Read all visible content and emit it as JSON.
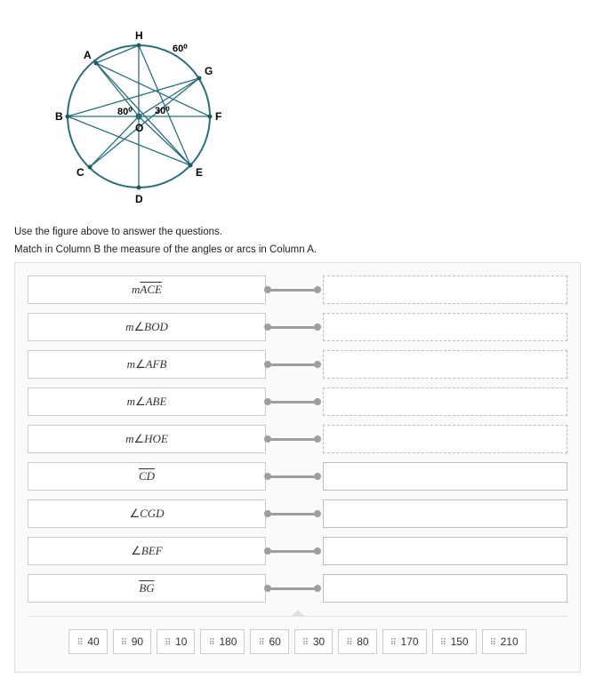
{
  "figure": {
    "points": {
      "A": "A",
      "B": "B",
      "C": "C",
      "D": "D",
      "E": "E",
      "F": "F",
      "G": "G",
      "H": "H",
      "O": "O"
    },
    "angles": {
      "HOG": "60⁰",
      "AOB": "80⁰",
      "O_right": "30⁰"
    }
  },
  "instructions": {
    "line1": "Use the figure above to answer the questions.",
    "line2": "Match in Column B the measure of the angles or arcs  in Column A."
  },
  "columnA": [
    {
      "prefix": "m",
      "arc": true,
      "body": "ACE"
    },
    {
      "prefix": "m",
      "angle": true,
      "body": "BOD"
    },
    {
      "prefix": "m",
      "angle": true,
      "body": "AFB"
    },
    {
      "prefix": "m",
      "angle": true,
      "body": "ABE"
    },
    {
      "prefix": "m",
      "angle": true,
      "body": "HOE"
    },
    {
      "prefix": "",
      "arc": true,
      "body": "CD"
    },
    {
      "prefix": "",
      "angle": true,
      "body": "CGD"
    },
    {
      "prefix": "",
      "angle": true,
      "body": "BEF"
    },
    {
      "prefix": "",
      "arc": true,
      "body": "BG"
    }
  ],
  "bank": [
    "40",
    "90",
    "10",
    "180",
    "60",
    "30",
    "80",
    "170",
    "150",
    "210"
  ],
  "chart_data": {
    "type": "diagram",
    "title": "Circle O with marked points and central angles",
    "center": "O",
    "points_on_circle": [
      "A",
      "B",
      "C",
      "D",
      "E",
      "F",
      "G",
      "H"
    ],
    "marked_angles": [
      {
        "vertex": "O",
        "rays": [
          "H",
          "G"
        ],
        "label": "60°"
      },
      {
        "vertex": "O",
        "rays": [
          "A",
          "B"
        ],
        "label": "80°"
      },
      {
        "vertex": "O",
        "rays": [
          "O-rightward",
          "F"
        ],
        "label": "30°"
      }
    ],
    "drawn_segments": [
      "AH",
      "AO",
      "AE",
      "AF",
      "BO",
      "BG",
      "BE",
      "CO",
      "CG",
      "DO",
      "HO",
      "HE",
      "GO",
      "FO",
      "EO"
    ]
  }
}
